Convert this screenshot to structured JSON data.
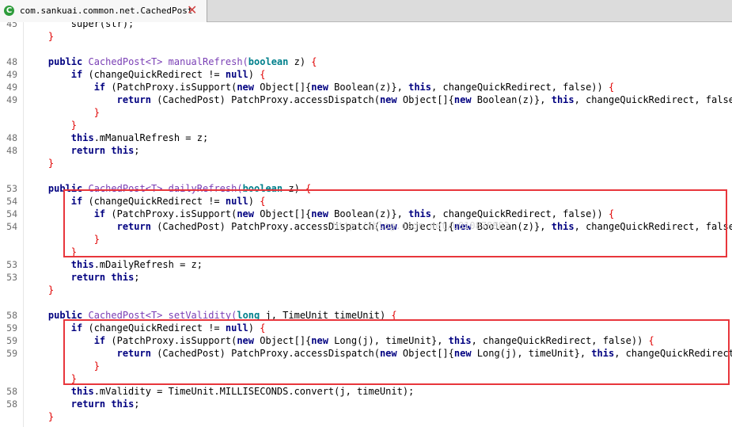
{
  "tab": {
    "icon": "class-c-icon",
    "icon_glyph": "C",
    "title": "com.sankuai.common.net.CachedPost",
    "close": "✕"
  },
  "colors": {
    "keyword": "#000080",
    "type": "#00808c",
    "method": "#7a3fb5",
    "bracket": "#e00000",
    "highlight_box": "#e8363c"
  },
  "code_lines": [
    {
      "num": "45",
      "segments": [
        {
          "t": "        super(str);",
          "c": "plain"
        }
      ]
    },
    {
      "num": "",
      "segments": [
        {
          "t": "    ",
          "c": "plain"
        },
        {
          "t": "}",
          "c": "br"
        }
      ]
    },
    {
      "num": "",
      "segments": []
    },
    {
      "num": "48",
      "segments": [
        {
          "t": "    ",
          "c": "plain"
        },
        {
          "t": "public",
          "c": "kw"
        },
        {
          "t": " CachedPost<T> ",
          "c": "fn"
        },
        {
          "t": "manualRefresh(",
          "c": "fn"
        },
        {
          "t": "boolean",
          "c": "ty"
        },
        {
          "t": " z) ",
          "c": "plain"
        },
        {
          "t": "{",
          "c": "br"
        }
      ]
    },
    {
      "num": "49",
      "segments": [
        {
          "t": "        ",
          "c": "plain"
        },
        {
          "t": "if",
          "c": "kw"
        },
        {
          "t": " (changeQuickRedirect != ",
          "c": "plain"
        },
        {
          "t": "null",
          "c": "kw"
        },
        {
          "t": ") ",
          "c": "plain"
        },
        {
          "t": "{",
          "c": "br"
        }
      ]
    },
    {
      "num": "49",
      "segments": [
        {
          "t": "            ",
          "c": "plain"
        },
        {
          "t": "if",
          "c": "kw"
        },
        {
          "t": " (PatchProxy.isSupport(",
          "c": "plain"
        },
        {
          "t": "new",
          "c": "kw"
        },
        {
          "t": " Object[]{",
          "c": "plain"
        },
        {
          "t": "new",
          "c": "kw"
        },
        {
          "t": " Boolean(z)}, ",
          "c": "plain"
        },
        {
          "t": "this",
          "c": "kw"
        },
        {
          "t": ", changeQuickRedirect, false)) ",
          "c": "plain"
        },
        {
          "t": "{",
          "c": "br"
        }
      ]
    },
    {
      "num": "49",
      "segments": [
        {
          "t": "                ",
          "c": "plain"
        },
        {
          "t": "return",
          "c": "kw"
        },
        {
          "t": " (CachedPost) PatchProxy.accessDispatch(",
          "c": "plain"
        },
        {
          "t": "new",
          "c": "kw"
        },
        {
          "t": " Object[]{",
          "c": "plain"
        },
        {
          "t": "new",
          "c": "kw"
        },
        {
          "t": " Boolean(z)}, ",
          "c": "plain"
        },
        {
          "t": "this",
          "c": "kw"
        },
        {
          "t": ", changeQuickRedirect, false);",
          "c": "plain"
        }
      ]
    },
    {
      "num": "",
      "segments": [
        {
          "t": "            ",
          "c": "plain"
        },
        {
          "t": "}",
          "c": "br"
        }
      ]
    },
    {
      "num": "",
      "segments": [
        {
          "t": "        ",
          "c": "plain"
        },
        {
          "t": "}",
          "c": "br"
        }
      ]
    },
    {
      "num": "48",
      "segments": [
        {
          "t": "        ",
          "c": "plain"
        },
        {
          "t": "this",
          "c": "kw"
        },
        {
          "t": ".mManualRefresh = z;",
          "c": "plain"
        }
      ]
    },
    {
      "num": "48",
      "segments": [
        {
          "t": "        ",
          "c": "plain"
        },
        {
          "t": "return",
          "c": "kw"
        },
        {
          "t": " ",
          "c": "plain"
        },
        {
          "t": "this",
          "c": "kw"
        },
        {
          "t": ";",
          "c": "plain"
        }
      ]
    },
    {
      "num": "",
      "segments": [
        {
          "t": "    ",
          "c": "plain"
        },
        {
          "t": "}",
          "c": "br"
        }
      ]
    },
    {
      "num": "",
      "segments": []
    },
    {
      "num": "53",
      "segments": [
        {
          "t": "    ",
          "c": "plain"
        },
        {
          "t": "public",
          "c": "kw"
        },
        {
          "t": " CachedPost<T> ",
          "c": "fn"
        },
        {
          "t": "dailyRefresh(",
          "c": "fn"
        },
        {
          "t": "boolean",
          "c": "ty"
        },
        {
          "t": " z) ",
          "c": "plain"
        },
        {
          "t": "{",
          "c": "br"
        }
      ]
    },
    {
      "num": "54",
      "segments": [
        {
          "t": "        ",
          "c": "plain"
        },
        {
          "t": "if",
          "c": "kw"
        },
        {
          "t": " (changeQuickRedirect != ",
          "c": "plain"
        },
        {
          "t": "null",
          "c": "kw"
        },
        {
          "t": ") ",
          "c": "plain"
        },
        {
          "t": "{",
          "c": "br"
        }
      ]
    },
    {
      "num": "54",
      "segments": [
        {
          "t": "            ",
          "c": "plain"
        },
        {
          "t": "if",
          "c": "kw"
        },
        {
          "t": " (PatchProxy.isSupport(",
          "c": "plain"
        },
        {
          "t": "new",
          "c": "kw"
        },
        {
          "t": " Object[]{",
          "c": "plain"
        },
        {
          "t": "new",
          "c": "kw"
        },
        {
          "t": " Boolean(z)}, ",
          "c": "plain"
        },
        {
          "t": "this",
          "c": "kw"
        },
        {
          "t": ", changeQuickRedirect, false)) ",
          "c": "plain"
        },
        {
          "t": "{",
          "c": "br"
        }
      ]
    },
    {
      "num": "54",
      "segments": [
        {
          "t": "                ",
          "c": "plain"
        },
        {
          "t": "return",
          "c": "kw"
        },
        {
          "t": " (CachedPost) PatchProxy.accessDispatch(",
          "c": "plain"
        },
        {
          "t": "new",
          "c": "kw"
        },
        {
          "t": " Object[]{",
          "c": "plain"
        },
        {
          "t": "new",
          "c": "kw"
        },
        {
          "t": " Boolean(z)}, ",
          "c": "plain"
        },
        {
          "t": "this",
          "c": "kw"
        },
        {
          "t": ", changeQuickRedirect, false);",
          "c": "plain"
        }
      ]
    },
    {
      "num": "",
      "segments": [
        {
          "t": "            ",
          "c": "plain"
        },
        {
          "t": "}",
          "c": "br"
        }
      ]
    },
    {
      "num": "",
      "segments": [
        {
          "t": "        ",
          "c": "plain"
        },
        {
          "t": "}",
          "c": "br"
        }
      ]
    },
    {
      "num": "53",
      "segments": [
        {
          "t": "        ",
          "c": "plain"
        },
        {
          "t": "this",
          "c": "kw"
        },
        {
          "t": ".mDailyRefresh = z;",
          "c": "plain"
        }
      ]
    },
    {
      "num": "53",
      "segments": [
        {
          "t": "        ",
          "c": "plain"
        },
        {
          "t": "return",
          "c": "kw"
        },
        {
          "t": " ",
          "c": "plain"
        },
        {
          "t": "this",
          "c": "kw"
        },
        {
          "t": ";",
          "c": "plain"
        }
      ]
    },
    {
      "num": "",
      "segments": [
        {
          "t": "    ",
          "c": "plain"
        },
        {
          "t": "}",
          "c": "br"
        }
      ]
    },
    {
      "num": "",
      "segments": []
    },
    {
      "num": "58",
      "segments": [
        {
          "t": "    ",
          "c": "plain"
        },
        {
          "t": "public",
          "c": "kw"
        },
        {
          "t": " CachedPost<T> ",
          "c": "fn"
        },
        {
          "t": "setValidity(",
          "c": "fn"
        },
        {
          "t": "long",
          "c": "ty"
        },
        {
          "t": " j, TimeUnit timeUnit) ",
          "c": "plain"
        },
        {
          "t": "{",
          "c": "br"
        }
      ]
    },
    {
      "num": "59",
      "segments": [
        {
          "t": "        ",
          "c": "plain"
        },
        {
          "t": "if",
          "c": "kw"
        },
        {
          "t": " (changeQuickRedirect != ",
          "c": "plain"
        },
        {
          "t": "null",
          "c": "kw"
        },
        {
          "t": ") ",
          "c": "plain"
        },
        {
          "t": "{",
          "c": "br"
        }
      ]
    },
    {
      "num": "59",
      "segments": [
        {
          "t": "            ",
          "c": "plain"
        },
        {
          "t": "if",
          "c": "kw"
        },
        {
          "t": " (PatchProxy.isSupport(",
          "c": "plain"
        },
        {
          "t": "new",
          "c": "kw"
        },
        {
          "t": " Object[]{",
          "c": "plain"
        },
        {
          "t": "new",
          "c": "kw"
        },
        {
          "t": " Long(j), timeUnit}, ",
          "c": "plain"
        },
        {
          "t": "this",
          "c": "kw"
        },
        {
          "t": ", changeQuickRedirect, false)) ",
          "c": "plain"
        },
        {
          "t": "{",
          "c": "br"
        }
      ]
    },
    {
      "num": "59",
      "segments": [
        {
          "t": "                ",
          "c": "plain"
        },
        {
          "t": "return",
          "c": "kw"
        },
        {
          "t": " (CachedPost) PatchProxy.accessDispatch(",
          "c": "plain"
        },
        {
          "t": "new",
          "c": "kw"
        },
        {
          "t": " Object[]{",
          "c": "plain"
        },
        {
          "t": "new",
          "c": "kw"
        },
        {
          "t": " Long(j), timeUnit}, ",
          "c": "plain"
        },
        {
          "t": "this",
          "c": "kw"
        },
        {
          "t": ", changeQuickRedirect, f",
          "c": "plain"
        }
      ]
    },
    {
      "num": "",
      "segments": [
        {
          "t": "            ",
          "c": "plain"
        },
        {
          "t": "}",
          "c": "br"
        }
      ]
    },
    {
      "num": "",
      "segments": [
        {
          "t": "        ",
          "c": "plain"
        },
        {
          "t": "}",
          "c": "br"
        }
      ]
    },
    {
      "num": "58",
      "segments": [
        {
          "t": "        ",
          "c": "plain"
        },
        {
          "t": "this",
          "c": "kw"
        },
        {
          "t": ".mValidity = TimeUnit.MILLISECONDS.convert(j, timeUnit);",
          "c": "plain"
        }
      ]
    },
    {
      "num": "58",
      "segments": [
        {
          "t": "        ",
          "c": "plain"
        },
        {
          "t": "return",
          "c": "kw"
        },
        {
          "t": " ",
          "c": "plain"
        },
        {
          "t": "this",
          "c": "kw"
        },
        {
          "t": ";",
          "c": "plain"
        }
      ]
    },
    {
      "num": "",
      "segments": [
        {
          "t": "    ",
          "c": "plain"
        },
        {
          "t": "}",
          "c": "br"
        }
      ]
    }
  ],
  "watermark": "http://blog.csdn.net/u010878883"
}
